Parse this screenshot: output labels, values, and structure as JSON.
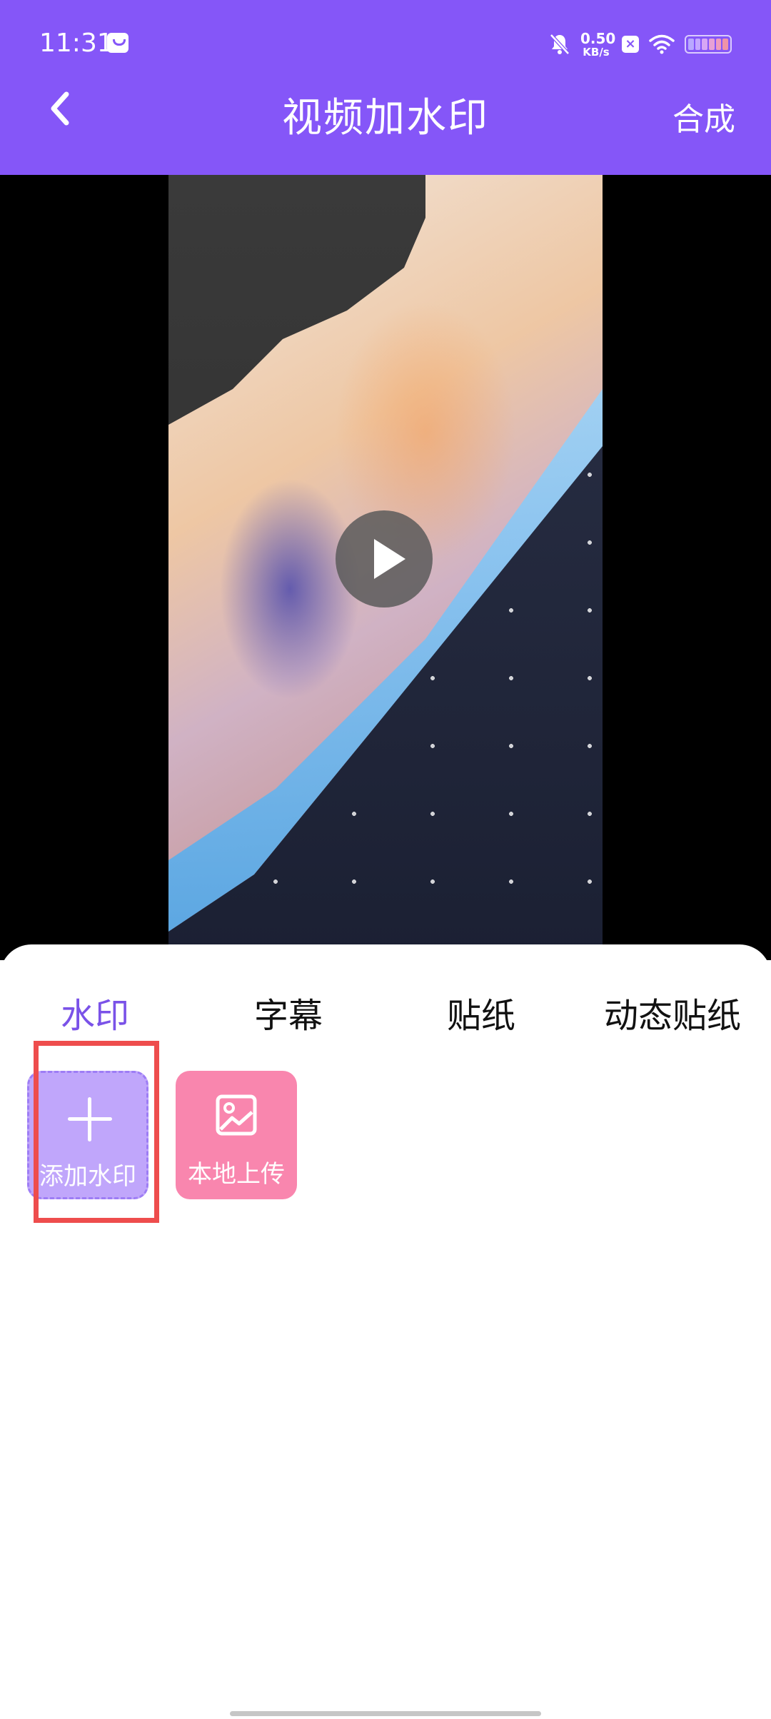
{
  "status_bar": {
    "time": "11:31",
    "net_speed_value": "0.50",
    "net_speed_unit": "KB/s",
    "x_badge": "×"
  },
  "header": {
    "title": "视频加水印",
    "compose_label": "合成",
    "background_color": "#8556f8"
  },
  "video": {
    "play_icon": "play-icon"
  },
  "tabs": [
    {
      "label": "水印",
      "active": true
    },
    {
      "label": "字幕",
      "active": false
    },
    {
      "label": "贴纸",
      "active": false
    },
    {
      "label": "动态贴纸",
      "active": false
    }
  ],
  "tiles": {
    "add_watermark": {
      "label": "添加水印",
      "icon": "plus-icon",
      "color": "#c0a6fb"
    },
    "local_upload": {
      "label": "本地上传",
      "icon": "image-icon",
      "color": "#f986ae"
    }
  },
  "accent_color": "#7a52e8",
  "highlight_color": "#ee4d4d"
}
